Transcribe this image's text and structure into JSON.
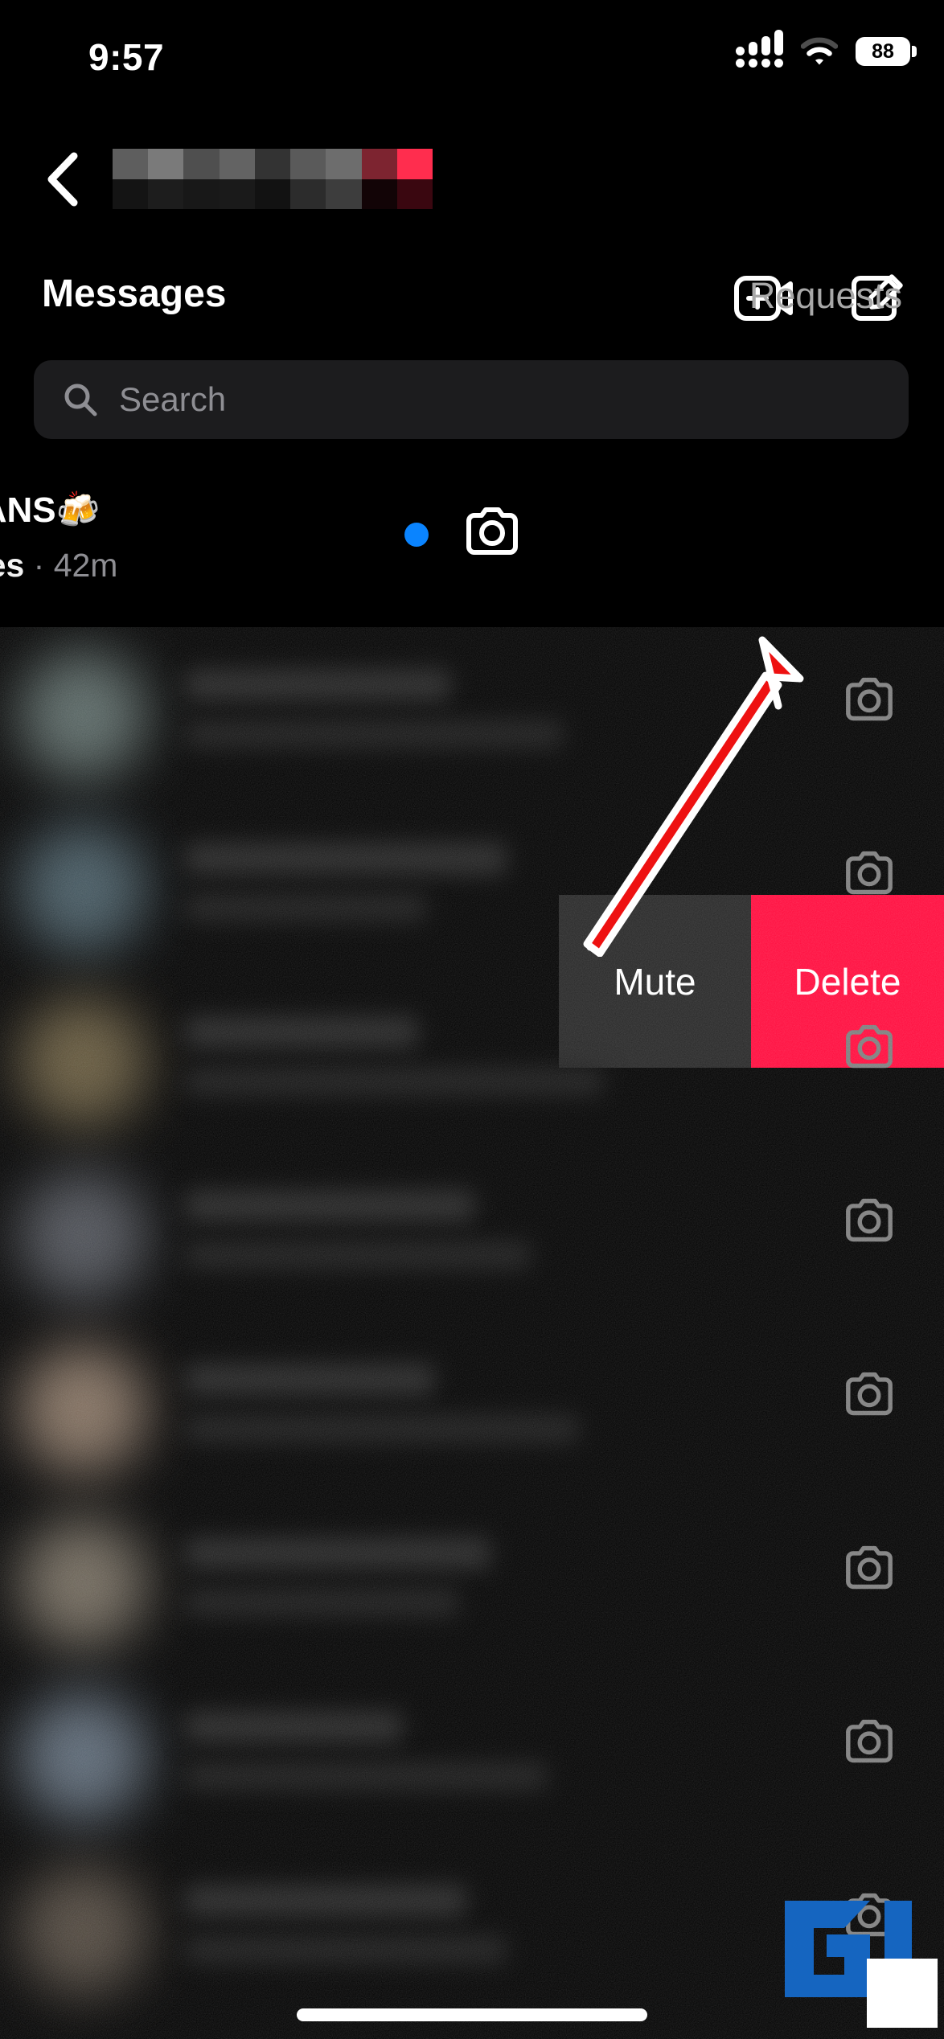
{
  "status_bar": {
    "time": "9:57",
    "signal_icon": "cellular-signal-icon",
    "wifi_icon": "wifi-icon",
    "battery_level": "88",
    "battery_icon": "battery-icon"
  },
  "top_nav": {
    "back_icon": "back-chevron-icon",
    "username_redacted": "",
    "video_call_icon": "video-call-add-icon",
    "compose_icon": "compose-new-message-icon"
  },
  "tabs": {
    "messages_label": "Messages",
    "requests_label": "Requests"
  },
  "search": {
    "placeholder": "Search",
    "value": "",
    "icon": "search-icon"
  },
  "swiped_conversation": {
    "title": "TITANS🍻",
    "subtitle_bold": "sages",
    "subtitle_dim": " · 42m",
    "unread_dot": "unread-indicator-dot",
    "camera_icon": "camera-icon",
    "actions": [
      {
        "label": "Mute",
        "name": "mute-button",
        "bg": "#262626"
      },
      {
        "label": "Delete",
        "name": "delete-button",
        "bg": "#ff0a3c"
      }
    ]
  },
  "annotation": {
    "arrow": "red-arrow-pointing-to-delete",
    "arrow_fill": "#ee1111",
    "arrow_stroke": "#ffffff"
  },
  "conversation_list": {
    "blurred": true,
    "row_count": 8,
    "camera_icon": "camera-icon",
    "avatar_colors": [
      "#7a8d8a",
      "#5f7a86",
      "#8b7a54",
      "#6b6f78",
      "#b39a84",
      "#9a8f7e",
      "#7d8ea0",
      "#6f6356"
    ]
  },
  "watermark": {
    "logo": "gadgets-to-use-logo",
    "brand_color": "#1565c0"
  },
  "home_indicator": "home-indicator-bar",
  "colors": {
    "background": "#000000",
    "search_field": "#1c1c1e",
    "accent_blue": "#0a84ff",
    "delete_red": "#ff0a3c",
    "mute_gray": "#262626",
    "secondary_text": "#8e8e93"
  }
}
